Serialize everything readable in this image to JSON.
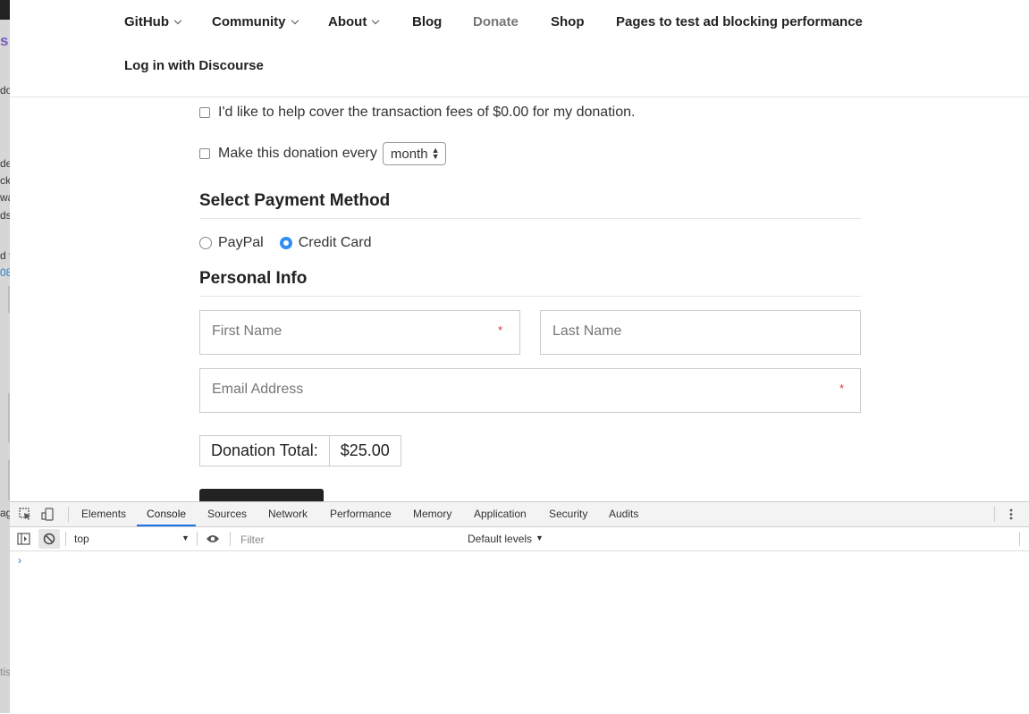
{
  "nav": {
    "items": [
      {
        "label": "GitHub",
        "dropdown": true
      },
      {
        "label": "Community",
        "dropdown": true
      },
      {
        "label": "About",
        "dropdown": true
      },
      {
        "label": "Blog",
        "dropdown": false
      },
      {
        "label": "Donate",
        "dropdown": false
      },
      {
        "label": "Shop",
        "dropdown": false
      },
      {
        "label": "Pages to test ad blocking performance",
        "dropdown": false
      }
    ],
    "login": "Log in with Discourse"
  },
  "form": {
    "cover_fees_label": "I'd like to help cover the transaction fees of $0.00 for my donation.",
    "recurring_label": "Make this donation every",
    "recurring_select": "month",
    "payment_title": "Select Payment Method",
    "payment_options": [
      "PayPal",
      "Credit Card"
    ],
    "payment_selected": "Credit Card",
    "personal_title": "Personal Info",
    "first_name_placeholder": "First Name",
    "last_name_placeholder": "Last Name",
    "email_placeholder": "Email Address",
    "required_mark": "*",
    "total_label": "Donation Total:",
    "total_amount": "$25.00"
  },
  "devtools": {
    "tabs": [
      "Elements",
      "Console",
      "Sources",
      "Network",
      "Performance",
      "Memory",
      "Application",
      "Security",
      "Audits"
    ],
    "active_tab": "Console",
    "context": "top",
    "filter_placeholder": "Filter",
    "levels": "Default levels",
    "prompt": "›"
  },
  "background_fragments": [
    "s",
    "do",
    "de",
    "ck",
    "wa",
    "ds",
    "d t",
    "08",
    "ag",
    "tis"
  ]
}
